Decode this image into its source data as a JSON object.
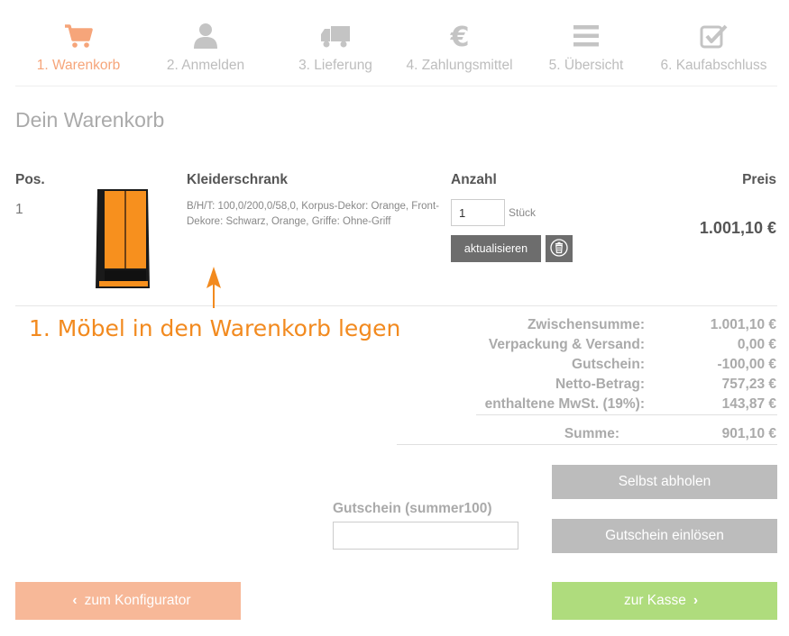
{
  "steps": [
    {
      "label": "1. Warenkorb",
      "icon": "cart-icon",
      "active": true
    },
    {
      "label": "2. Anmelden",
      "icon": "user-icon",
      "active": false
    },
    {
      "label": "3. Lieferung",
      "icon": "truck-icon",
      "active": false
    },
    {
      "label": "4. Zahlungsmittel",
      "icon": "euro-icon",
      "active": false
    },
    {
      "label": "5. Übersicht",
      "icon": "list-icon",
      "active": false
    },
    {
      "label": "6. Kaufabschluss",
      "icon": "checkbox-icon",
      "active": false
    }
  ],
  "page_title": "Dein Warenkorb",
  "table": {
    "headers": {
      "pos": "Pos.",
      "product": "Kleiderschrank",
      "qty": "Anzahl",
      "price": "Preis"
    },
    "row": {
      "pos": "1",
      "description": "B/H/T: 100,0/200,0/58,0, Korpus-Dekor: Orange, Front-Dekore: Schwarz, Orange, Griffe: Ohne-Griff",
      "qty": "1",
      "unit": "Stück",
      "update_label": "aktualisieren",
      "price": "1.001,10 €"
    }
  },
  "annotation": "1. Möbel in den Warenkorb legen",
  "totals": [
    {
      "label": "Zwischensumme:",
      "value": "1.001,10 €"
    },
    {
      "label": "Verpackung & Versand:",
      "value": "0,00 €"
    },
    {
      "label": "Gutschein:",
      "value": "-100,00 €"
    },
    {
      "label": "Netto-Betrag:",
      "value": "757,23 €"
    },
    {
      "label": "enthaltene MwSt. (19%):",
      "value": "143,87 €"
    }
  ],
  "sum": {
    "label": "Summe:",
    "value": "901,10 €"
  },
  "buttons": {
    "pickup": "Selbst abholen",
    "redeem": "Gutschein einlösen",
    "back": "zum Konfigurator",
    "checkout": "zur Kasse"
  },
  "coupon": {
    "label": "Gutschein (summer100)",
    "value": ""
  },
  "colors": {
    "accent": "#f6a57a",
    "checkout": "#afdc7d",
    "back": "#f7b898",
    "annotation": "#f28a1f"
  }
}
